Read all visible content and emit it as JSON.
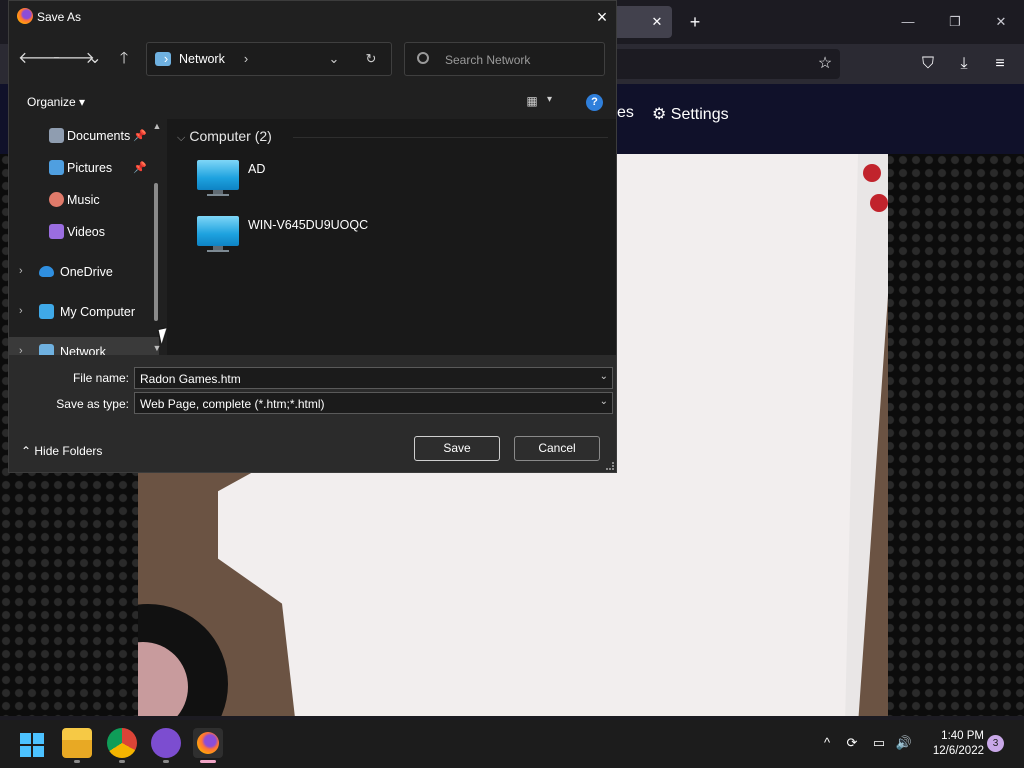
{
  "dialog": {
    "title": "Save As",
    "close_icon": "×",
    "nav": {
      "back": "🡐",
      "forward": "🡒",
      "recent": "⌄",
      "up": "🡑"
    },
    "address": {
      "location": "Network",
      "separator": "›",
      "dropdown": "⌄",
      "refresh": "↻"
    },
    "search": {
      "placeholder": "Search Network"
    },
    "toolbar": {
      "organize": "Organize ▾",
      "view_icon": "▦",
      "view_caret": "▾",
      "help": "?"
    },
    "nav_pane": {
      "items": [
        {
          "label": "Documents",
          "pinned": true,
          "icon_color": "#8f9db0"
        },
        {
          "label": "Pictures",
          "pinned": true,
          "icon_color": "#4f9fe0"
        },
        {
          "label": "Music",
          "pinned": false,
          "icon_color": "#e07a6a"
        },
        {
          "label": "Videos",
          "pinned": false,
          "icon_color": "#9a6de0"
        },
        {
          "label": "OneDrive",
          "expandable": true,
          "icon_color": "#2f8fe0"
        },
        {
          "label": "My Computer",
          "expandable": true,
          "icon_color": "#3fa9e8"
        },
        {
          "label": "Network",
          "expandable": true,
          "selected": true,
          "icon_color": "#6fb1e0"
        }
      ],
      "pin_glyph": "📌",
      "chevron_glyph": "›"
    },
    "content": {
      "group_header": "Computer (2)",
      "group_chevron": "⌵",
      "items": [
        {
          "name": "AD"
        },
        {
          "name": "WIN-V645DU9UOQC"
        }
      ]
    },
    "form": {
      "file_name_label": "File name:",
      "file_name_value": "Radon Games.htm",
      "save_type_label": "Save as type:",
      "save_type_value": "Web Page, complete (*.htm;*.html)",
      "caret": "⌄"
    },
    "hide_folders": "⌃  Hide Folders",
    "save_button": "Save",
    "cancel_button": "Cancel"
  },
  "browser": {
    "tab_close": "✕",
    "new_tab": "+",
    "window_controls": {
      "minimize": "—",
      "maximize": "❐",
      "close": "✕"
    },
    "toolbar_icons": {
      "bookmark": "☆",
      "pocket": "⛉",
      "download": "⤓",
      "menu": "≡"
    },
    "site_nav": {
      "partial": "es",
      "settings": "⚙ Settings"
    }
  },
  "taskbar": {
    "apps": [
      {
        "name": "start"
      },
      {
        "name": "file-explorer"
      },
      {
        "name": "chrome"
      },
      {
        "name": "github-desktop"
      },
      {
        "name": "firefox",
        "active": true
      }
    ],
    "tray": {
      "overflow": "^",
      "sync": "⟳",
      "display": "▭",
      "volume": "🔊"
    },
    "time": "1:40 PM",
    "date": "12/6/2022",
    "notifications": "3"
  }
}
